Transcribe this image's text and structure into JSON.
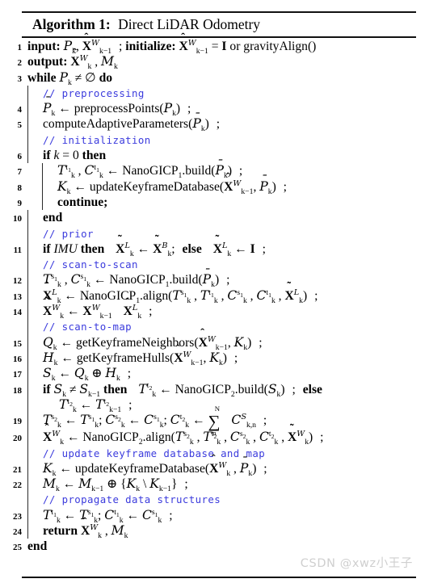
{
  "algorithm": {
    "label": "Algorithm 1:",
    "title": "Direct LiDAR Odometry",
    "comment_color": "#3b3bdd",
    "watermark": "CSDN @xwz小王子"
  },
  "lines": [
    {
      "num": "1",
      "text": "input: P_k, X̂^W_{k−1} ; initialize: X̂^W_{k−1} = I or gravityAlign()"
    },
    {
      "num": "2",
      "text": "output: X̂^W_k , M_k"
    },
    {
      "num": "3",
      "text": "while P_k ≠ ∅ do"
    },
    {
      "num": "",
      "text": "// preprocessing",
      "kind": "comment"
    },
    {
      "num": "4",
      "text": "P̄_k ← preprocessPoints(P_k) ;"
    },
    {
      "num": "5",
      "text": "computeAdaptiveParameters(P̄_k) ;"
    },
    {
      "num": "",
      "text": "// initialization",
      "kind": "comment"
    },
    {
      "num": "6",
      "text": "if k = 0 then"
    },
    {
      "num": "7",
      "text": "T^t1_k , C^t1_k ← NanoGICP_1.build(P̄_k) ;"
    },
    {
      "num": "8",
      "text": "K_k ← updateKeyframeDatabase(X̂^W_{k−1}, P̄_k) ;"
    },
    {
      "num": "9",
      "text": "continue;"
    },
    {
      "num": "10",
      "text": "end"
    },
    {
      "num": "",
      "text": "// prior",
      "kind": "comment"
    },
    {
      "num": "11",
      "text": "if IMU then  X̃^L_k ← X̃^B_k;  else  X̃^L_k ← I ;"
    },
    {
      "num": "",
      "text": "// scan-to-scan",
      "kind": "comment"
    },
    {
      "num": "12",
      "text": "T^s1_k , C^s1_k ← NanoGICP_1.build(P̄_k) ;"
    },
    {
      "num": "13",
      "text": "X̂^L_k ← NanoGICP_1.align(T^s1_k , T^t1_k , C^s1_k , C^t1_k , X̃^L_k) ;"
    },
    {
      "num": "14",
      "text": "X̃^W_k ← X̂^W_{k−1} X̂^L_k ;"
    },
    {
      "num": "",
      "text": "// scan-to-map",
      "kind": "comment"
    },
    {
      "num": "15",
      "text": "Q_k ← getKeyframeNeighbors(X̂^W_{k−1}, K_k) ;"
    },
    {
      "num": "16",
      "text": "H_k ← getKeyframeHulls(X̂^W_{k−1}, K_k) ;"
    },
    {
      "num": "17",
      "text": "S_k ← Q_k ⊕ H_k ;"
    },
    {
      "num": "18",
      "text": "if S_k ≠ S_{k−1} then  T^t2_k ← NanoGICP_2.build(S_k) ;  else T^t2_k ← T^t2_{k−1} ;"
    },
    {
      "num": "19",
      "text": "T^s2_k ← T^s1_k; C^s2_k ← C^s1_k; C^t2_k ← Σ^N_n C^S_{k,n} ;"
    },
    {
      "num": "20",
      "text": "X̂^W_k ← NanoGICP_2.align(T^s2_k , T^t2_k , C^s2_k , C^t2_k , X̃^W_k) ;"
    },
    {
      "num": "",
      "text": "// update keyframe database and map",
      "kind": "comment"
    },
    {
      "num": "21",
      "text": "K_k ← updateKeyframeDatabase(X̂^W_k , P̄_k) ;"
    },
    {
      "num": "22",
      "text": "M_k ← M_{k−1} ⊕ {K_k \\ K_{k−1}} ;"
    },
    {
      "num": "",
      "text": "// propagate data structures",
      "kind": "comment"
    },
    {
      "num": "23",
      "text": "T^t1_k ← T^s1_k; C^t1_k ← C^s1_k ;"
    },
    {
      "num": "24",
      "text": "return X̂^W_k , M_k"
    },
    {
      "num": "25",
      "text": "end"
    }
  ]
}
